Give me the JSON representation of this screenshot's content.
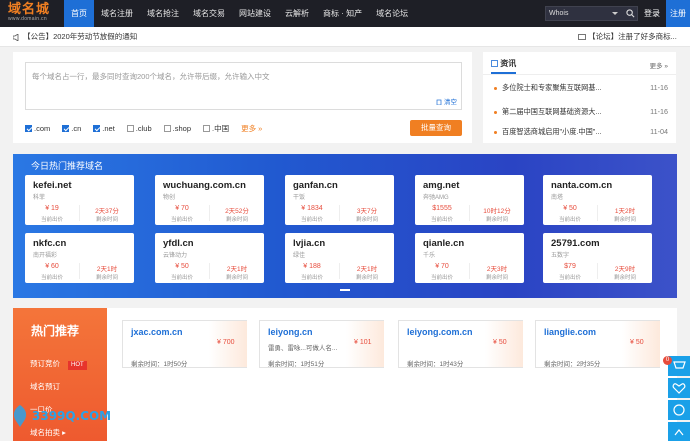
{
  "logo": {
    "main": "域名城",
    "sub": "www.domain.cn"
  },
  "nav": {
    "items": [
      "首页",
      "域名注册",
      "域名抢注",
      "域名交易",
      "网站建设",
      "云解析",
      "商标 · 知产",
      "域名论坛"
    ],
    "search_select": "Whois",
    "login": "登录",
    "register": "注册"
  },
  "announcement": {
    "left": "【公告】2020年劳动节放假的通知",
    "right": "【论坛】注册了好多商标..."
  },
  "query": {
    "placeholder": "每个域名占一行，最多同时查询200个域名，允许带后缀，允许输入中文",
    "clear": "清空",
    "tlds": [
      {
        "label": ".com",
        "checked": true
      },
      {
        "label": ".cn",
        "checked": true
      },
      {
        "label": ".net",
        "checked": true
      },
      {
        "label": ".club",
        "checked": false
      },
      {
        "label": ".shop",
        "checked": false
      },
      {
        "label": ".中国",
        "checked": false
      }
    ],
    "more": "更多 »",
    "button": "批量查询"
  },
  "news": {
    "title": "资讯",
    "more": "更多 »",
    "items": [
      {
        "text": "多位院士和专家聚焦互联网基...",
        "date": "11-16"
      },
      {
        "text": "第二届中国互联网基础资源大...",
        "date": "11-16"
      },
      {
        "text": "百度智选商城启用\"小度.中国\"...",
        "date": "11-04"
      }
    ]
  },
  "hot": {
    "title": "今日热门推荐域名",
    "price_label": "当前出价",
    "time_label": "剩余时间",
    "cards": [
      {
        "domain": "kefei.net",
        "desc": "科菲",
        "price": "¥ 19",
        "time": "2天37分"
      },
      {
        "domain": "wuchuang.com.cn",
        "desc": "物创",
        "price": "¥ 70",
        "time": "2天52分"
      },
      {
        "domain": "ganfan.cn",
        "desc": "干饭",
        "price": "¥ 1834",
        "time": "3天7分"
      },
      {
        "domain": "amg.net",
        "desc": "奔驰AMG",
        "price": "$1555",
        "time": "10时12分"
      },
      {
        "domain": "nanta.com.cn",
        "desc": "南塔",
        "price": "¥ 50",
        "time": "1天2时"
      },
      {
        "domain": "nkfc.cn",
        "desc": "南开福彩",
        "price": "¥ 60",
        "time": "2天1时"
      },
      {
        "domain": "yfdl.cn",
        "desc": "云锋动力",
        "price": "¥ 50",
        "time": "2天1时"
      },
      {
        "domain": "lvjia.cn",
        "desc": "绿佳",
        "price": "¥ 188",
        "time": "2天1时"
      },
      {
        "domain": "qianle.cn",
        "desc": "千乐",
        "price": "¥ 70",
        "time": "2天3时"
      },
      {
        "domain": "25791.com",
        "desc": "五数字",
        "price": "$79",
        "time": "2天9时"
      }
    ]
  },
  "recommend": {
    "title": "热门推荐",
    "menu": [
      {
        "label": "预订竞价",
        "badge": "HOT"
      },
      {
        "label": "域名预订",
        "badge": ""
      },
      {
        "label": "一口价",
        "badge": ""
      },
      {
        "label": "域名拍卖 ▸",
        "badge": ""
      }
    ],
    "time_prefix": "剩余时间：",
    "cards": [
      {
        "domain": "jxac.com.cn",
        "desc": "",
        "price": "¥ 700",
        "time": "1时50分"
      },
      {
        "domain": "leiyong.cn",
        "desc": "雷勇、雷咏...可做人名...",
        "price": "¥ 101",
        "time": "1时51分"
      },
      {
        "domain": "leiyong.com.cn",
        "desc": "",
        "price": "¥ 50",
        "time": "1时43分"
      },
      {
        "domain": "lianglie.com",
        "desc": "",
        "price": "¥ 50",
        "time": "2时35分"
      }
    ]
  },
  "watermark": "3399Q.COM",
  "side": {
    "cart_count": "0"
  }
}
